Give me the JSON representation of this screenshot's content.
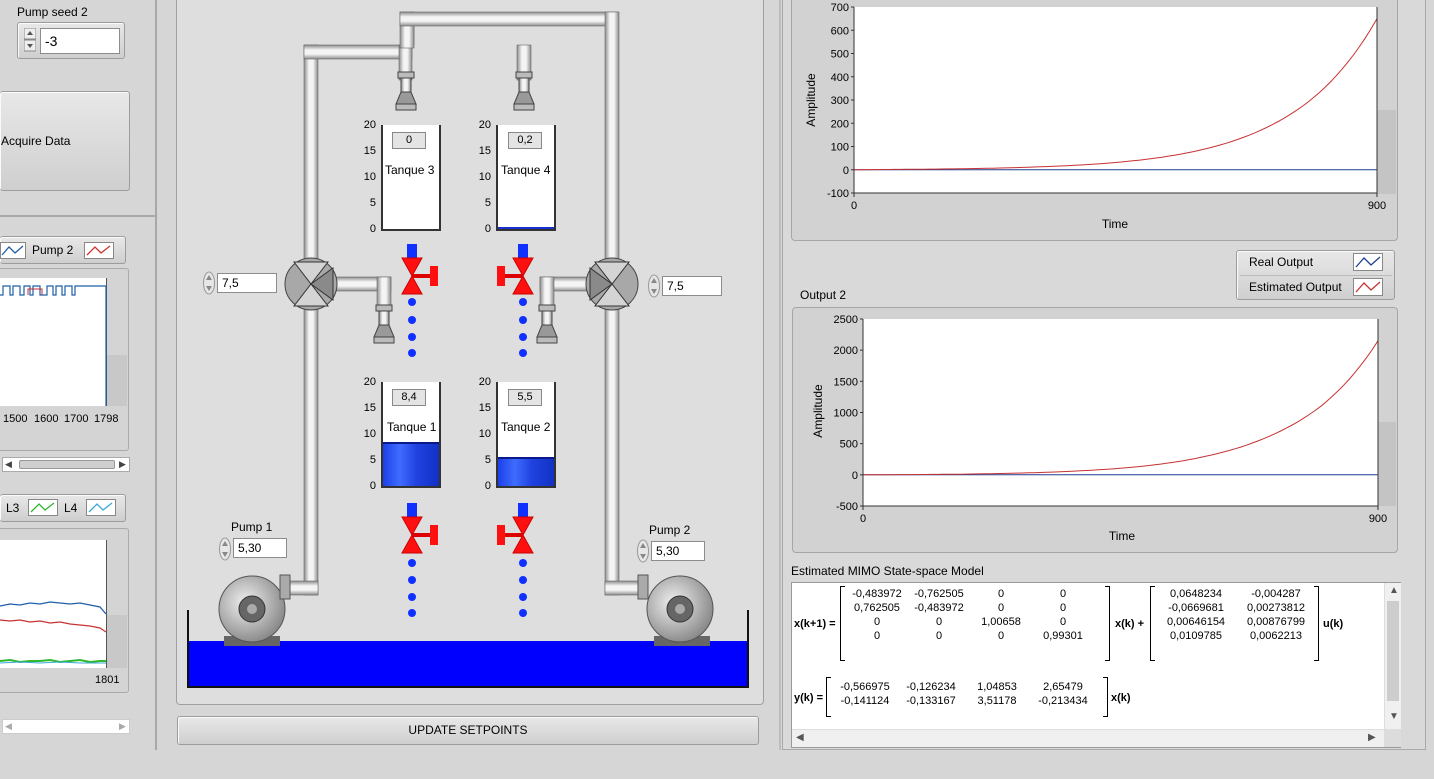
{
  "left": {
    "pump_seed_label": "Pump seed 2",
    "pump_seed_value": "-3",
    "acquire_label": "Acquire Data",
    "legend_top": {
      "pump2": "Pump 2"
    },
    "chart_top_ticks": [
      "1500",
      "1600",
      "1700",
      "1798"
    ],
    "legend_bottom": {
      "l3": "L3",
      "l4": "L4"
    },
    "chart_bottom_tick": "1801"
  },
  "plant": {
    "tanks": [
      {
        "name": "Tanque 3",
        "value": "0",
        "level": 0
      },
      {
        "name": "Tanque 4",
        "value": "0,2",
        "level": 0.2
      },
      {
        "name": "Tanque 1",
        "value": "8,4",
        "level": 8.4
      },
      {
        "name": "Tanque 2",
        "value": "5,5",
        "level": 5.5
      }
    ],
    "tank_scale": [
      "20",
      "15",
      "10",
      "5",
      "0"
    ],
    "valve_left_value": "7,5",
    "valve_right_value": "7,5",
    "pump1_label": "Pump 1",
    "pump1_value": "5,30",
    "pump2_label": "Pump 2",
    "pump2_value": "5,30",
    "update_button": "UPDATE SETPOINTS"
  },
  "right": {
    "output1": {
      "ylabel": "Amplitude",
      "xlabel": "Time",
      "yticks": [
        "700",
        "600",
        "500",
        "400",
        "300",
        "200",
        "100",
        "0",
        "-100"
      ],
      "xticks": [
        "0",
        "900"
      ]
    },
    "legend": {
      "real": "Real Output",
      "estimated": "Estimated Output"
    },
    "output2": {
      "title": "Output 2",
      "ylabel": "Amplitude",
      "xlabel": "Time",
      "yticks": [
        "2500",
        "2000",
        "1500",
        "1000",
        "500",
        "0",
        "-500"
      ],
      "xticks": [
        "0",
        "900"
      ]
    },
    "model": {
      "title": "Estimated MIMO State-space Model",
      "xk1_label": "x(k+1) =",
      "xk_label1": "x(k) +",
      "uk_label": "u(k)",
      "yk_label": "y(k) =",
      "xk_label2": "x(k)",
      "A": [
        [
          "-0,483972",
          "-0,762505",
          "0",
          "0"
        ],
        [
          "0,762505",
          "-0,483972",
          "0",
          "0"
        ],
        [
          "0",
          "0",
          "1,00658",
          "0"
        ],
        [
          "0",
          "0",
          "0",
          "0,99301"
        ]
      ],
      "B": [
        [
          "0,0648234",
          "-0,004287"
        ],
        [
          "-0,0669681",
          "0,00273812"
        ],
        [
          "0,00646154",
          "0,00876799"
        ],
        [
          "0,0109785",
          "0,0062213"
        ]
      ],
      "C": [
        [
          "-0,566975",
          "-0,126234",
          "1,04853",
          "2,65479"
        ],
        [
          "-0,141124",
          "-0,133167",
          "3,51178",
          "-0,213434"
        ]
      ]
    }
  },
  "chart_data": [
    {
      "type": "line",
      "xlabel": "Time",
      "ylabel": "Amplitude",
      "xlim": [
        0,
        900
      ],
      "ylim": [
        -100,
        700
      ],
      "series": [
        {
          "name": "Real Output",
          "color": "#1f3f8f",
          "x": [
            0,
            900
          ],
          "y": [
            0,
            0
          ]
        },
        {
          "name": "Estimated Output",
          "color": "#c83232",
          "x": [
            0,
            100,
            200,
            300,
            400,
            500,
            600,
            700,
            800,
            900
          ],
          "y": [
            0,
            2,
            5,
            11,
            22,
            44,
            87,
            170,
            330,
            650
          ]
        }
      ]
    },
    {
      "type": "line",
      "title": "Output 2",
      "xlabel": "Time",
      "ylabel": "Amplitude",
      "xlim": [
        0,
        900
      ],
      "ylim": [
        -500,
        2500
      ],
      "series": [
        {
          "name": "Real Output",
          "color": "#1f3f8f",
          "x": [
            0,
            900
          ],
          "y": [
            0,
            0
          ]
        },
        {
          "name": "Estimated Output",
          "color": "#c83232",
          "x": [
            0,
            100,
            200,
            300,
            400,
            500,
            600,
            700,
            800,
            900
          ],
          "y": [
            0,
            5,
            15,
            35,
            75,
            150,
            300,
            580,
            1100,
            2150
          ]
        }
      ]
    }
  ]
}
